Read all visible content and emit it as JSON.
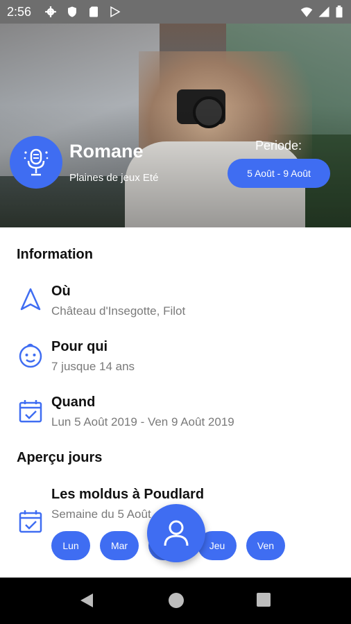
{
  "status_bar": {
    "time": "2:56"
  },
  "hero": {
    "name": "Romane",
    "subtitle": "Plaines de jeux Eté",
    "periode_label": "Periode:",
    "periode_value": "5 Août - 9 Août"
  },
  "information": {
    "title": "Information",
    "items": [
      {
        "icon": "navigation-icon",
        "title": "Où",
        "value": "Château d'Insegotte, Filot"
      },
      {
        "icon": "baby-face-icon",
        "title": "Pour qui",
        "value": "7 jusque 14 ans"
      },
      {
        "icon": "calendar-check-icon",
        "title": "Quand",
        "value": "Lun 5 Août 2019 - Ven 9 Août 2019"
      }
    ]
  },
  "apercu": {
    "title": "Aperçu jours",
    "week_title": "Les moldus à Poudlard",
    "week_sub": "Semaine du 5 Août",
    "days": [
      "Lun",
      "Mar",
      "Mer",
      "Jeu",
      "Ven"
    ]
  },
  "colors": {
    "accent": "#3f6df2",
    "status_bar": "#6e6e6e",
    "nav_bar": "#000000"
  }
}
